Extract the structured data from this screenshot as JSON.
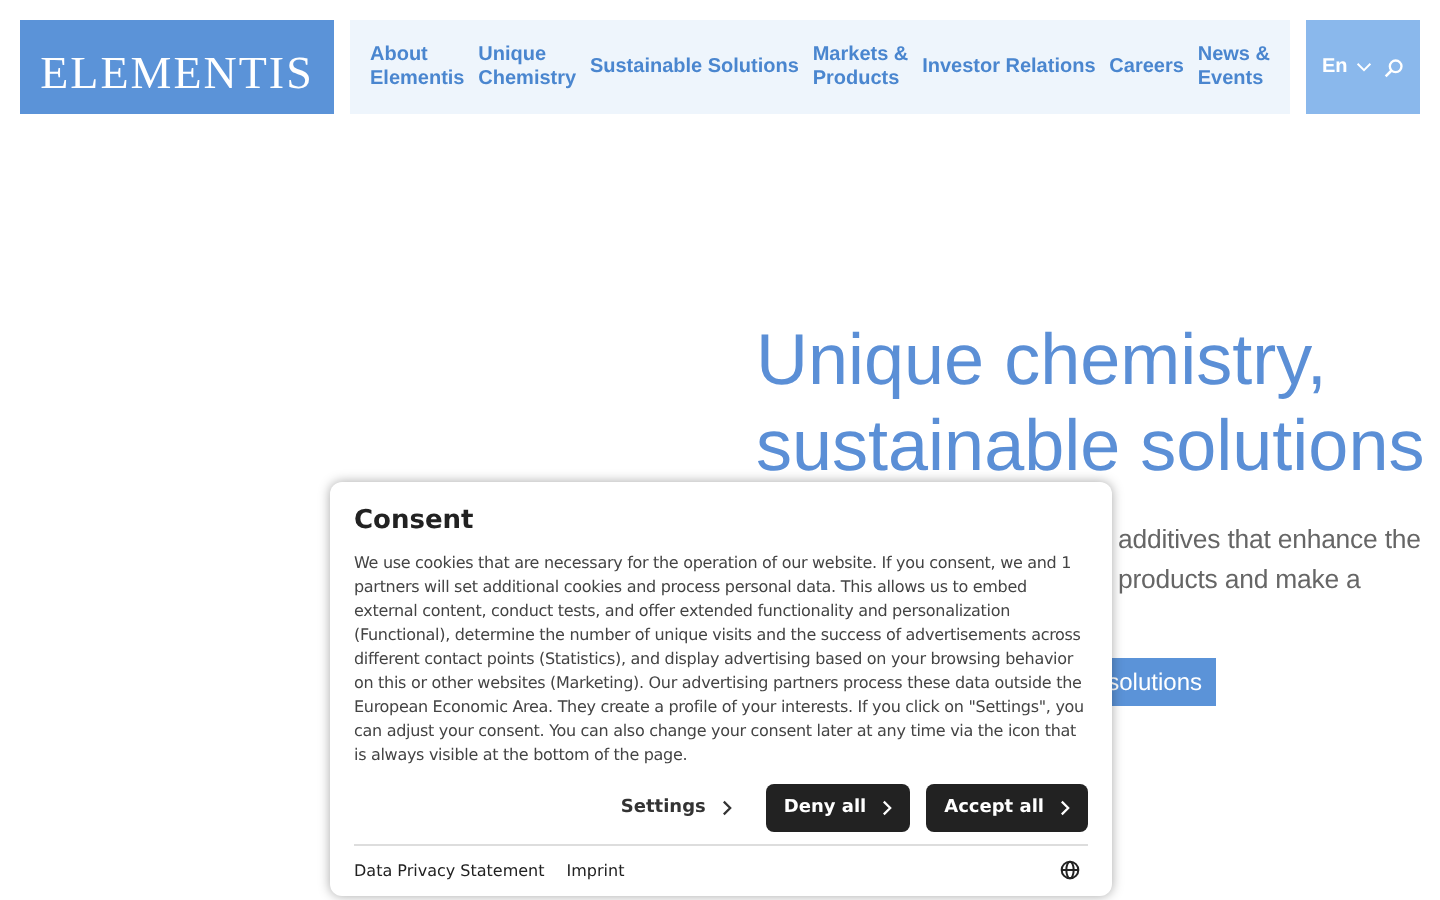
{
  "header": {
    "logo": "ELEMENTIS",
    "nav": [
      "About\nElementis",
      "Unique\nChemistry",
      "Sustainable Solutions",
      "Markets &\nProducts",
      "Investor Relations",
      "Careers",
      "News &\nEvents"
    ],
    "language": "En"
  },
  "hero": {
    "title": "Unique chemistry,\nsustainable solutions",
    "text_lines": [
      "additives that enhance the",
      "products and make a"
    ],
    "button": "solutions"
  },
  "consent": {
    "title": "Consent",
    "body": "We use cookies that are necessary for the operation of our website. If you consent, we and 1 partners will set additional cookies and process personal data. This allows us to embed external content, conduct tests, and offer extended functionality and personalization (Functional), determine the number of unique visits and the success of advertisements across different contact points (Statistics), and display advertising based on your browsing behavior on this or other websites (Marketing). Our advertising partners process these data outside the European Economic Area. They create a profile of your interests. If you click on \"Settings\", you can adjust your consent. You can also change your consent later at any time via the icon that is always visible at the bottom of the page.",
    "buttons": [
      {
        "label": "Settings",
        "kind": "link"
      },
      {
        "label": "Deny all",
        "kind": "dark"
      },
      {
        "label": "Accept all",
        "kind": "dark"
      }
    ],
    "footer_links": [
      "Data Privacy Statement",
      "Imprint"
    ]
  }
}
